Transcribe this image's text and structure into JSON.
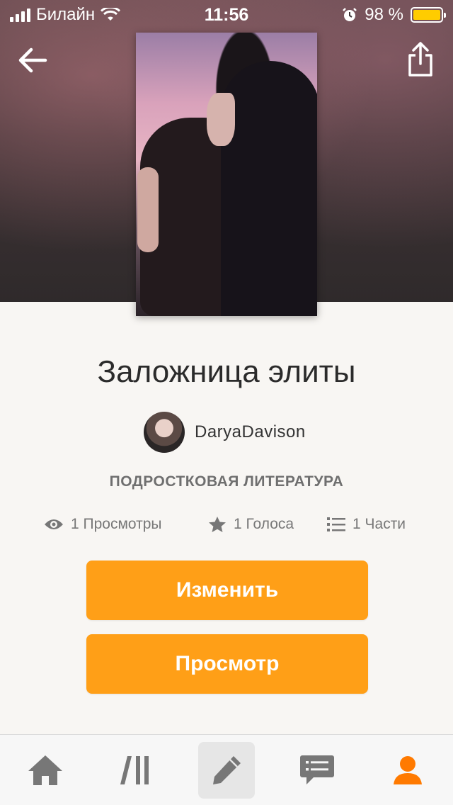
{
  "status_bar": {
    "carrier": "Билайн",
    "time": "11:56",
    "battery": "98 %"
  },
  "story": {
    "title": "Заложница элиты",
    "author": "DaryaDavison",
    "category": "ПОДРОСТКОВАЯ ЛИТЕРАТУРА"
  },
  "stats": {
    "views": "1 Просмотры",
    "votes": "1 Голоса",
    "parts": "1 Части"
  },
  "buttons": {
    "edit": "Изменить",
    "view": "Просмотр"
  },
  "colors": {
    "accent": "#ff9f17",
    "profile_tab": "#ff7a00",
    "icon_gray": "#777777"
  },
  "tabbar": {
    "items": [
      "home-icon",
      "library-icon",
      "write-icon",
      "messages-icon",
      "profile-icon"
    ],
    "active": "write-icon"
  }
}
